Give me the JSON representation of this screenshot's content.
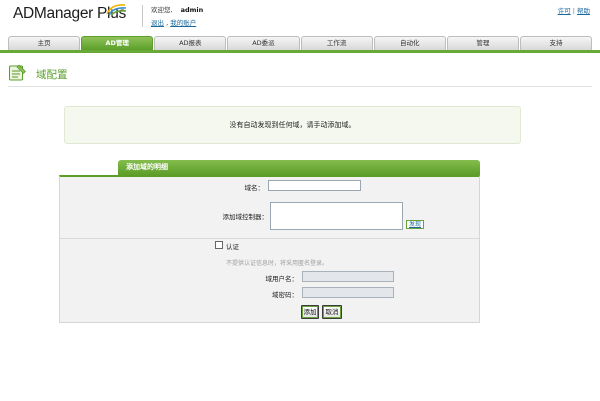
{
  "header": {
    "logo_text": "ADManager Plus",
    "welcome_label": "欢迎您,",
    "username": "admin",
    "logout_link": "退出",
    "separator_comma": ",",
    "account_link": "我的账户",
    "license_link": "许可",
    "divider": "|",
    "help_link": "帮助"
  },
  "tabs": [
    {
      "label": "主页"
    },
    {
      "label": "AD管理"
    },
    {
      "label": "AD报表"
    },
    {
      "label": "AD委派"
    },
    {
      "label": "工作流"
    },
    {
      "label": "自动化"
    },
    {
      "label": "管理"
    },
    {
      "label": "支持"
    }
  ],
  "active_tab": "AD管理",
  "page": {
    "title": "域配置"
  },
  "notice": {
    "text": "没有自动发现到任何域，请手动添加域。"
  },
  "form": {
    "header": "添加域的明细",
    "domain_name_label": "域名：",
    "domain_name_value": "",
    "controller_label": "添加域控制器：",
    "controller_value": "",
    "discover_button": "发现",
    "auth_checkbox_label": "认证",
    "auth_checked": false,
    "auth_hint": "不提供认证信息时，将采用匿名登录。",
    "username_label": "域用户名：",
    "password_label": "域密码：",
    "add_button": "添加",
    "cancel_button": "取消"
  },
  "colors": {
    "brand_green": "#5c9d28",
    "link_blue": "#1a6aa0"
  }
}
